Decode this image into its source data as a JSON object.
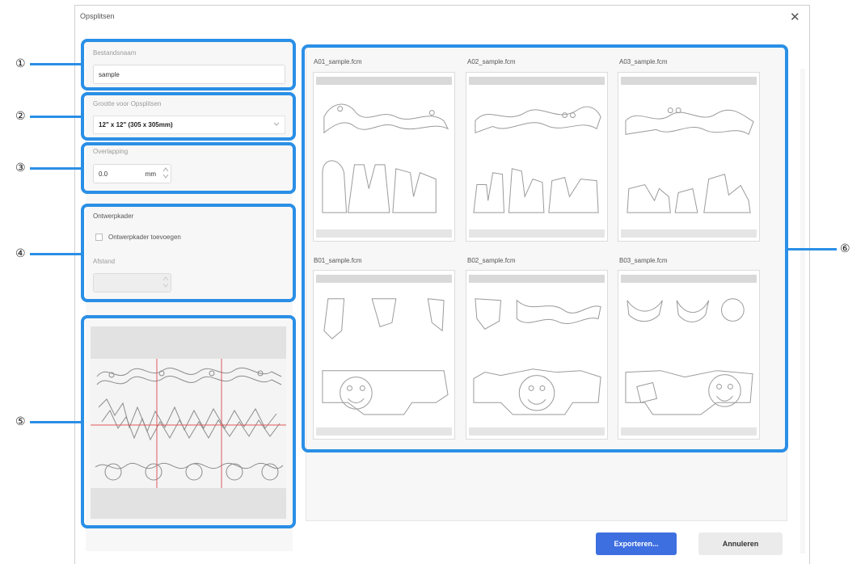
{
  "dialog": {
    "title": "Opsplitsen",
    "close_glyph": "✕"
  },
  "settings": {
    "filename_label": "Bestandsnaam",
    "filename_value": "sample",
    "size_label": "Grootte voor Opsplitsen",
    "size_value": "12\" x 12\" (305 x 305mm)",
    "overlap_label": "Overlapping",
    "overlap_value": "0.0",
    "overlap_unit": "mm",
    "frame_label": "Ontwerpkader",
    "frame_checkbox_label": "Ontwerpkader toevoegen",
    "frame_checked": false,
    "distance_label": "Afstand",
    "distance_value": ""
  },
  "preview": {
    "alt": "Halloween design split preview"
  },
  "files": [
    {
      "name": "A01_sample.fcm"
    },
    {
      "name": "A02_sample.fcm"
    },
    {
      "name": "A03_sample.fcm"
    },
    {
      "name": "B01_sample.fcm"
    },
    {
      "name": "B02_sample.fcm"
    },
    {
      "name": "B03_sample.fcm"
    }
  ],
  "buttons": {
    "export": "Exporteren...",
    "cancel": "Annuleren"
  },
  "callouts": [
    "①",
    "②",
    "③",
    "④",
    "⑤",
    "⑥"
  ],
  "colors": {
    "highlight": "#2a8fe6",
    "primary_button": "#3d6fe0"
  },
  "icons": {
    "close": "close-icon",
    "dropdown": "chevron-down-icon",
    "spinner": "spinner-arrows-icon"
  }
}
